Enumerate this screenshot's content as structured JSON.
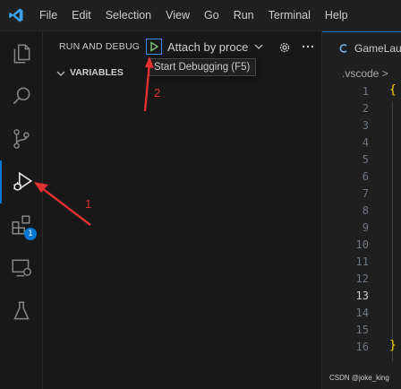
{
  "menubar": {
    "items": [
      "File",
      "Edit",
      "Selection",
      "View",
      "Go",
      "Run",
      "Terminal",
      "Help"
    ]
  },
  "activity_bar": {
    "items": [
      {
        "name": "explorer",
        "icon": "files-icon"
      },
      {
        "name": "search",
        "icon": "search-icon"
      },
      {
        "name": "source-control",
        "icon": "source-control-icon"
      },
      {
        "name": "run-and-debug",
        "icon": "run-debug-icon",
        "active": true
      },
      {
        "name": "extensions",
        "icon": "extensions-icon",
        "badge": "1"
      },
      {
        "name": "remote-explorer",
        "icon": "remote-explorer-icon"
      },
      {
        "name": "testing",
        "icon": "flask-icon"
      }
    ]
  },
  "sidebar": {
    "title": "RUN AND DEBUG",
    "configuration": "Attach by proce",
    "tooltip": "Start Debugging (F5)",
    "section": "VARIABLES"
  },
  "editor": {
    "tab_label": "GameLau",
    "breadcrumb": ".vscode >",
    "line_numbers": [
      "1",
      "2",
      "3",
      "4",
      "5",
      "6",
      "7",
      "8",
      "9",
      "10",
      "11",
      "12",
      "13",
      "14",
      "15",
      "16"
    ],
    "current_line": "13",
    "code": {
      "open": "{",
      "close": "}"
    }
  },
  "annotations": {
    "label_1": "1",
    "label_2": "2"
  },
  "watermark": "CSDN @joke_king",
  "colors": {
    "accent": "#0078d4",
    "arrow": "#e03030",
    "bracket": "#ffd700"
  }
}
